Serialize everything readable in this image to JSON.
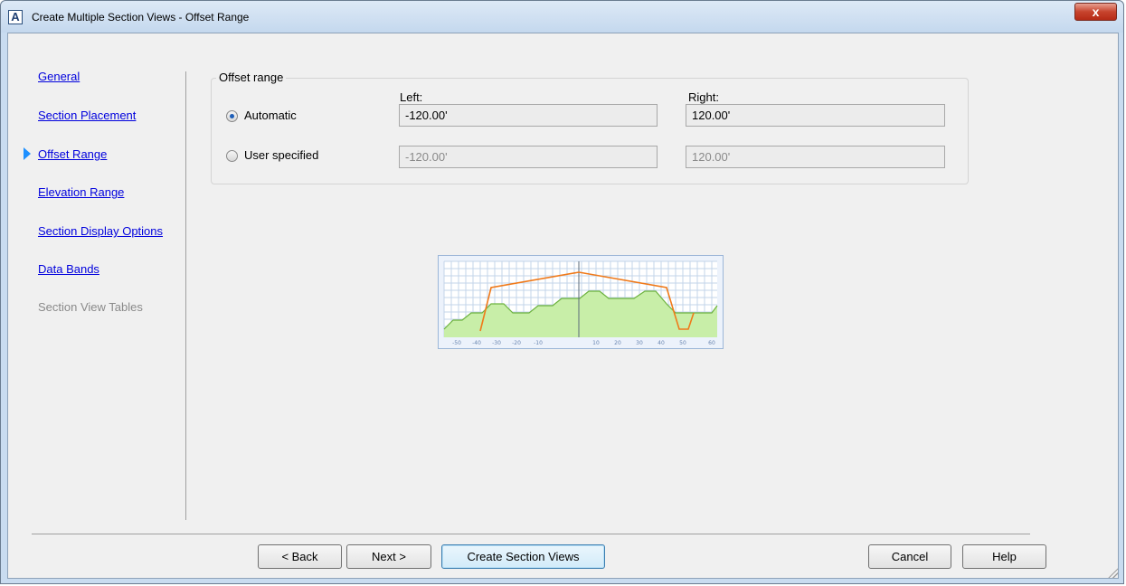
{
  "window": {
    "title": "Create Multiple Section Views - Offset Range",
    "close_glyph": "x"
  },
  "nav": {
    "items": [
      {
        "label": "General",
        "enabled": true,
        "current": false
      },
      {
        "label": "Section Placement",
        "enabled": true,
        "current": false
      },
      {
        "label": "Offset Range",
        "enabled": true,
        "current": true
      },
      {
        "label": "Elevation Range",
        "enabled": true,
        "current": false
      },
      {
        "label": "Section Display Options",
        "enabled": true,
        "current": false
      },
      {
        "label": "Data Bands",
        "enabled": true,
        "current": false
      },
      {
        "label": "Section View Tables",
        "enabled": false,
        "current": false
      }
    ]
  },
  "offset_range": {
    "legend": "Offset range",
    "left_label": "Left:",
    "right_label": "Right:",
    "automatic": {
      "label": "Automatic",
      "checked": true,
      "left_value": "-120.00'",
      "right_value": "120.00'"
    },
    "user_specified": {
      "label": "User specified",
      "checked": false,
      "left_value": "-120.00'",
      "right_value": "120.00'"
    }
  },
  "preview": {
    "x_ticks": [
      "-50",
      "-40",
      "-30",
      "-20",
      "-10",
      "10",
      "20",
      "30",
      "40",
      "50",
      "60"
    ],
    "colors": {
      "ground": "#6db33f",
      "ground_fill": "#c8eea8",
      "section": "#f07a1a",
      "grid": "#c3d4ea"
    }
  },
  "buttons": {
    "back": "< Back",
    "next": "Next >",
    "create": "Create Section Views",
    "cancel": "Cancel",
    "help": "Help"
  }
}
